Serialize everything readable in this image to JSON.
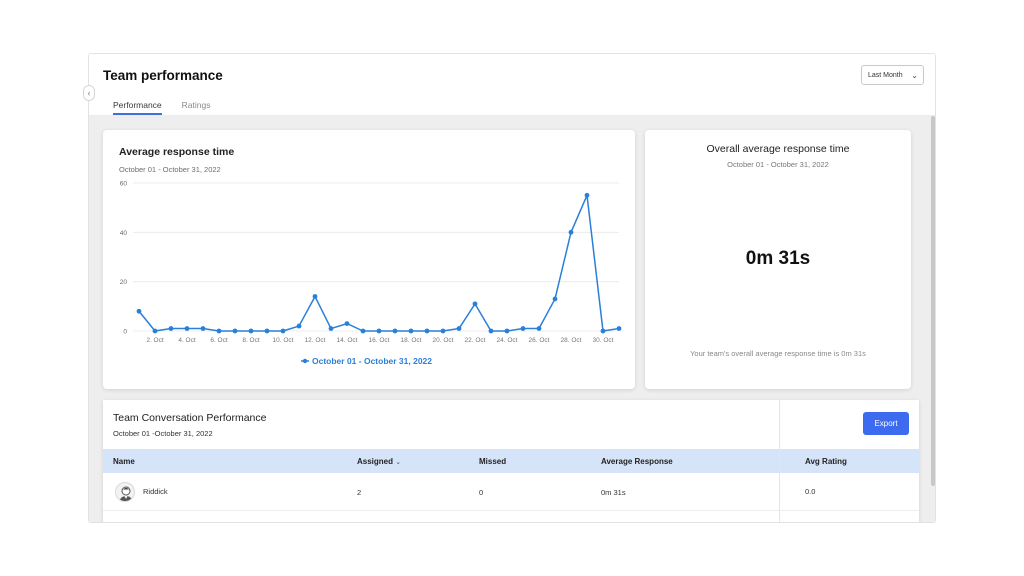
{
  "header": {
    "title": "Team performance",
    "tabs": [
      {
        "label": "Performance",
        "active": true
      },
      {
        "label": "Ratings",
        "active": false
      }
    ],
    "range_select": {
      "value": "Last Month"
    }
  },
  "collapse_icon": "chevron-left-icon",
  "response_chart": {
    "title": "Average response time",
    "date_range": "October 01 - October 31, 2022"
  },
  "overall": {
    "title": "Overall average response time",
    "date_range": "October 01 - October 31, 2022",
    "value": "0m 31s",
    "note": "Your team's overall average response time is 0m 31s"
  },
  "conversation_table": {
    "title": "Team Conversation Performance",
    "date_range": "October 01 -October 31, 2022",
    "export_label": "Export",
    "columns": [
      "Name",
      "Assigned",
      "Missed",
      "Average Response",
      "Avg Rating"
    ],
    "sort_icon": "chevron-down-icon",
    "rows": [
      {
        "name": "Riddick",
        "assigned": "2",
        "missed": "0",
        "average_response": "0m 31s",
        "avg_rating": "0.0",
        "avatar_icon": "user-avatar-icon"
      }
    ]
  },
  "colors": {
    "accent": "#3d6bf0",
    "series": "#2a7fd9",
    "table_header": "#d6e4f9"
  },
  "chart_data": {
    "type": "line",
    "x": [
      "1. Oct",
      "2. Oct",
      "3. Oct",
      "4. Oct",
      "5. Oct",
      "6. Oct",
      "7. Oct",
      "8. Oct",
      "9. Oct",
      "10. Oct",
      "11. Oct",
      "12. Oct",
      "13. Oct",
      "14. Oct",
      "15. Oct",
      "16. Oct",
      "17. Oct",
      "18. Oct",
      "19. Oct",
      "20. Oct",
      "21. Oct",
      "22. Oct",
      "23. Oct",
      "24. Oct",
      "25. Oct",
      "26. Oct",
      "27. Oct",
      "28. Oct",
      "29. Oct",
      "30. Oct",
      "31. Oct"
    ],
    "x_tick_labels": [
      "2. Oct",
      "4. Oct",
      "6. Oct",
      "8. Oct",
      "10. Oct",
      "12. Oct",
      "14. Oct",
      "16. Oct",
      "18. Oct",
      "20. Oct",
      "22. Oct",
      "24. Oct",
      "26. Oct",
      "28. Oct",
      "30. Oct"
    ],
    "series": [
      {
        "name": "October 01 - October 31, 2022",
        "values": [
          8,
          0,
          1,
          1,
          1,
          0,
          0,
          0,
          0,
          0,
          2,
          14,
          1,
          3,
          0,
          0,
          0,
          0,
          0,
          0,
          1,
          11,
          0,
          0,
          1,
          1,
          13,
          40,
          55,
          0,
          1
        ]
      }
    ],
    "y_ticks": [
      0,
      20,
      40,
      60
    ],
    "ylim": [
      0,
      60
    ],
    "grid": true,
    "legend": "bottom-center"
  }
}
